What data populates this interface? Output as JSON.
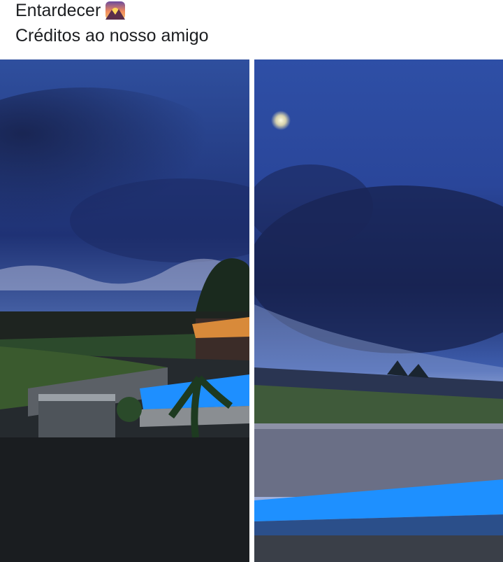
{
  "post": {
    "caption_line1": "Entardecer",
    "caption_line2": "Créditos ao nosso amigo",
    "caption_emoji": "sunset-over-mountains-icon"
  },
  "photos": [
    {
      "description_name": "evening-pool-photo-left"
    },
    {
      "description_name": "evening-sky-moon-pool-photo-right"
    }
  ],
  "colors": {
    "text": "#1c1e21",
    "sky_dark": "#1b2a5e",
    "sky_mid": "#3a5aa8",
    "pool_blue": "#1e8fff"
  }
}
